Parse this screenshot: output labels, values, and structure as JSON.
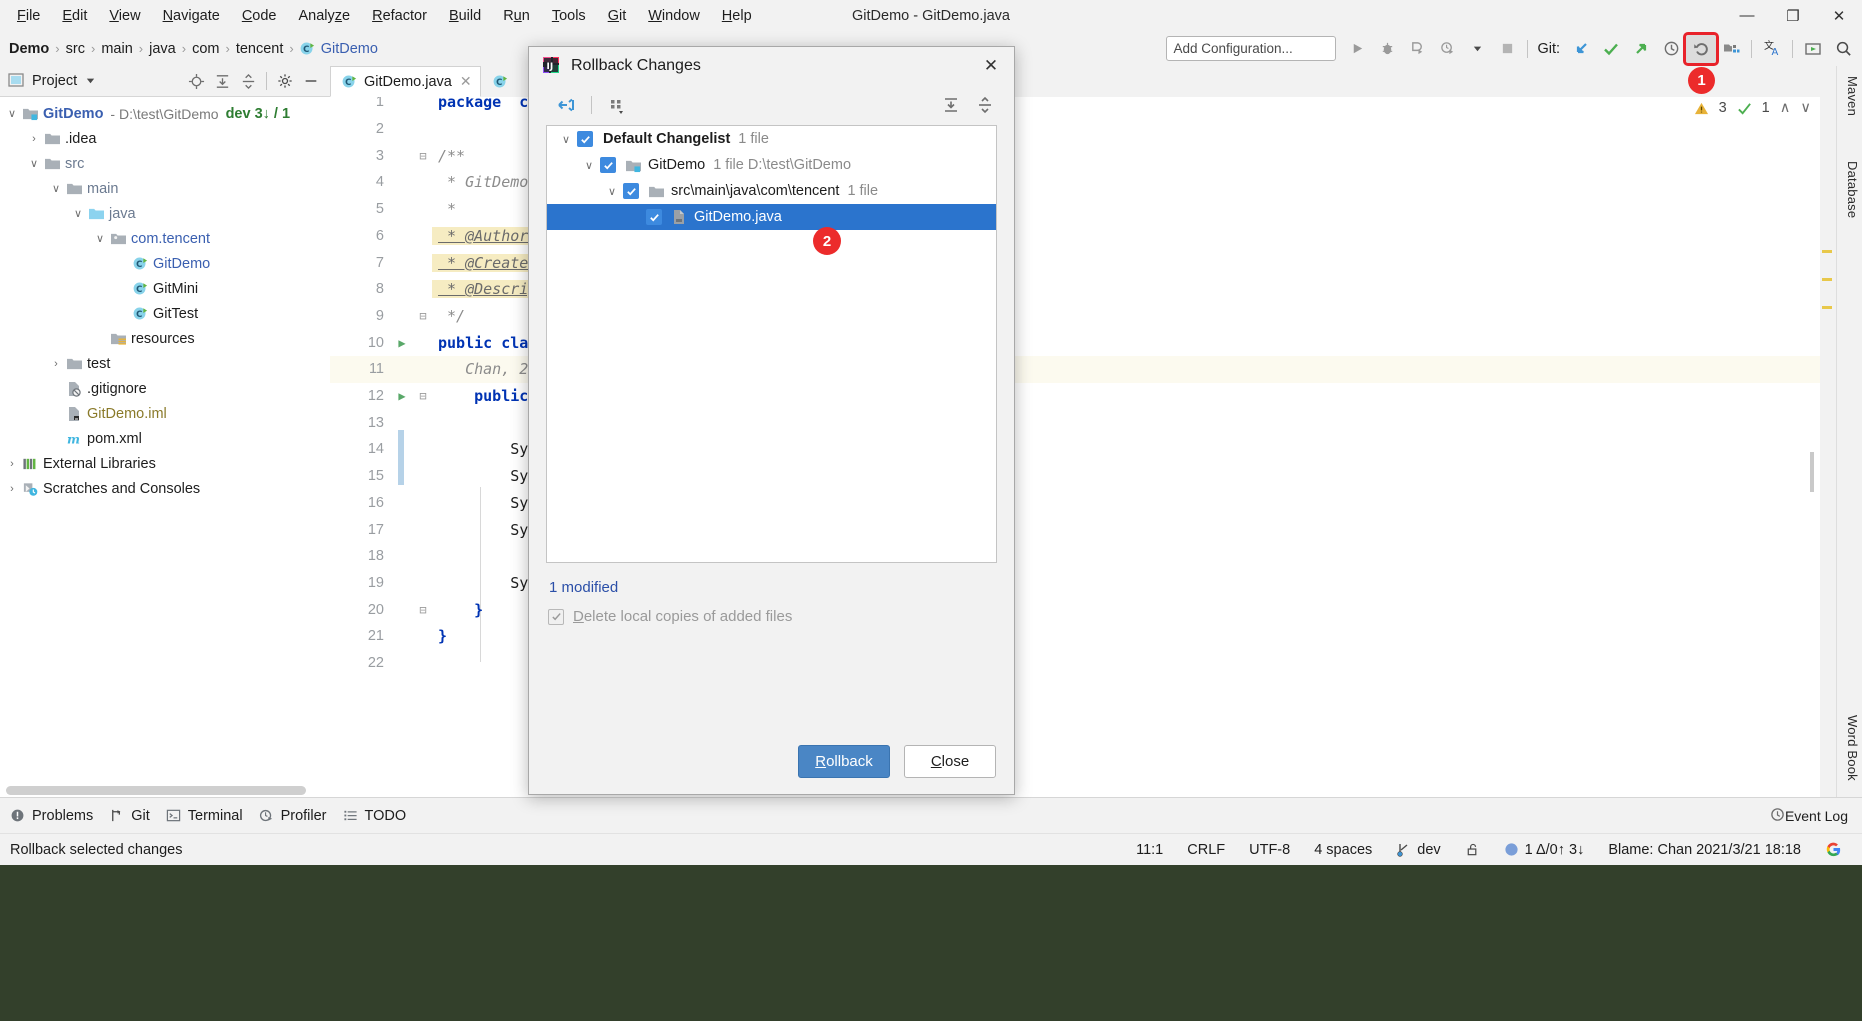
{
  "window": {
    "title": "GitDemo - GitDemo.java",
    "minimize": "—",
    "maximize": "❐",
    "close": "✕"
  },
  "menubar": [
    {
      "label": "File",
      "mn": "F"
    },
    {
      "label": "Edit",
      "mn": "E"
    },
    {
      "label": "View",
      "mn": "V"
    },
    {
      "label": "Navigate",
      "mn": "N"
    },
    {
      "label": "Code",
      "mn": "C"
    },
    {
      "label": "Analyze",
      "mn": "z"
    },
    {
      "label": "Refactor",
      "mn": "R"
    },
    {
      "label": "Build",
      "mn": "B"
    },
    {
      "label": "Run",
      "mn": "u"
    },
    {
      "label": "Tools",
      "mn": "T"
    },
    {
      "label": "Git",
      "mn": "G"
    },
    {
      "label": "Window",
      "mn": "W"
    },
    {
      "label": "Help",
      "mn": "H"
    }
  ],
  "breadcrumb": {
    "items": [
      "Demo",
      "src",
      "main",
      "java",
      "com",
      "tencent",
      "GitDemo"
    ],
    "separator": "›"
  },
  "toolbar": {
    "run_config_placeholder": "Add Configuration...",
    "git_label": "Git:",
    "badge_1": "1",
    "icons": [
      "run-icon",
      "debug-icon",
      "run-coverage-icon",
      "profile-icon",
      "dropdown-icon",
      "stop-icon",
      "git-update-icon",
      "git-commit-icon",
      "git-push-icon",
      "git-history-icon",
      "git-rollback-icon",
      "project-structure-icon",
      "translate-icon",
      "presentation-icon",
      "search-icon"
    ]
  },
  "project_panel": {
    "title": "Project",
    "tools": [
      "locate-icon",
      "expand-all-icon",
      "collapse-all-icon",
      "settings-icon",
      "hide-icon"
    ],
    "tree": [
      {
        "label": "GitDemo",
        "meta": "- D:\\test\\GitDemo",
        "branch": "dev 3↓ / 1",
        "indent": 0,
        "chev": "∨",
        "icon": "module-folder-icon",
        "style": "bold blue"
      },
      {
        "label": ".idea",
        "indent": 1,
        "chev": "›",
        "icon": "folder-icon",
        "style": ""
      },
      {
        "label": "src",
        "indent": 1,
        "chev": "∨",
        "icon": "folder-icon",
        "style": "grayblue"
      },
      {
        "label": "main",
        "indent": 2,
        "chev": "∨",
        "icon": "folder-icon",
        "style": "grayblue"
      },
      {
        "label": "java",
        "indent": 3,
        "chev": "∨",
        "icon": "source-folder-icon",
        "style": "grayblue"
      },
      {
        "label": "com.tencent",
        "indent": 4,
        "chev": "∨",
        "icon": "package-icon",
        "style": "blue"
      },
      {
        "label": "GitDemo",
        "indent": 5,
        "chev": "",
        "icon": "java-class-icon",
        "style": "blue"
      },
      {
        "label": "GitMini",
        "indent": 5,
        "chev": "",
        "icon": "java-class-icon",
        "style": ""
      },
      {
        "label": "GitTest",
        "indent": 5,
        "chev": "",
        "icon": "java-class-icon",
        "style": ""
      },
      {
        "label": "resources",
        "indent": 4,
        "chev": "",
        "icon": "resources-folder-icon",
        "style": ""
      },
      {
        "label": "test",
        "indent": 2,
        "chev": "›",
        "icon": "folder-icon",
        "style": ""
      },
      {
        "label": ".gitignore",
        "indent": 2,
        "chev": "",
        "icon": "gitignore-file-icon",
        "style": ""
      },
      {
        "label": "GitDemo.iml",
        "indent": 2,
        "chev": "",
        "icon": "iml-file-icon",
        "style": "olive"
      },
      {
        "label": "pom.xml",
        "indent": 2,
        "chev": "",
        "icon": "maven-icon",
        "style": ""
      },
      {
        "label": "External Libraries",
        "indent": 0,
        "chev": "›",
        "icon": "libraries-icon",
        "style": ""
      },
      {
        "label": "Scratches and Consoles",
        "indent": 0,
        "chev": "›",
        "icon": "scratches-icon",
        "style": ""
      }
    ]
  },
  "editor": {
    "tabs": [
      {
        "label": "GitDemo.java",
        "icon": "java-class-icon",
        "active": true,
        "close": "✕"
      },
      {
        "label": "",
        "icon": "java-class-icon",
        "active": false,
        "close": ""
      }
    ],
    "inspection": {
      "warnings": "3",
      "checks": "1",
      "warn_icon": "warning-triangle-icon",
      "check_icon": "check-icon",
      "up": "∧",
      "down": "∨"
    },
    "lines": [
      {
        "n": "1",
        "text": "package  com.",
        "cls": "k"
      },
      {
        "n": "2",
        "text": "",
        "cls": ""
      },
      {
        "n": "3",
        "text": "/**",
        "cls": "cm",
        "fold": "⊟"
      },
      {
        "n": "4",
        "text": " * GitDemo.j",
        "cls": "cm"
      },
      {
        "n": "5",
        "text": " *",
        "cls": "cm"
      },
      {
        "n": "6",
        "text": " * @Author:",
        "cls": "cmhl"
      },
      {
        "n": "7",
        "text": " * @CreateTi",
        "cls": "cmhl"
      },
      {
        "n": "8",
        "text": " * @Descript",
        "cls": "cmhl"
      },
      {
        "n": "9",
        "text": " */",
        "cls": "cm",
        "fold": "⊟"
      },
      {
        "n": "10",
        "text": "public class",
        "cls": "k",
        "mark": "▶"
      },
      {
        "n": "11",
        "text": "   Chan, 202",
        "cls": "cm",
        "hl": true
      },
      {
        "n": "12",
        "text": "    public s",
        "cls": "k",
        "mark": "▶",
        "fold": "⊟"
      },
      {
        "n": "13",
        "text": "",
        "cls": ""
      },
      {
        "n": "14",
        "text": "        Syst",
        "cls": ""
      },
      {
        "n": "15",
        "text": "        Syst",
        "cls": ""
      },
      {
        "n": "16",
        "text": "        Syst",
        "cls": ""
      },
      {
        "n": "17",
        "text": "        Syst",
        "cls": ""
      },
      {
        "n": "18",
        "text": "",
        "cls": ""
      },
      {
        "n": "19",
        "text": "        Syst",
        "cls": ""
      },
      {
        "n": "20",
        "text": "    }",
        "cls": "k",
        "fold": "⊟"
      },
      {
        "n": "21",
        "text": "}",
        "cls": "k"
      },
      {
        "n": "22",
        "text": "",
        "cls": ""
      }
    ]
  },
  "right_strip": {
    "labels": [
      "Maven",
      "Database",
      "Word Book"
    ]
  },
  "dialog": {
    "title": "Rollback Changes",
    "icon": "intellij-idea-icon",
    "close": "✕",
    "toolbar_icons": [
      "collapse-all-icon",
      "group-by-icon"
    ],
    "toolbar_right_icons": [
      "expand-all-icon",
      "collapse-all-icon"
    ],
    "tree": [
      {
        "label": "Default Changelist",
        "meta": "1 file",
        "indent": 0,
        "chev": "∨",
        "icon": "",
        "bold": true,
        "selected": false
      },
      {
        "label": "GitDemo",
        "meta": "1 file  D:\\test\\GitDemo",
        "indent": 1,
        "chev": "∨",
        "icon": "module-folder-icon",
        "bold": false,
        "selected": false
      },
      {
        "label": "src\\main\\java\\com\\tencent",
        "meta": "1 file",
        "indent": 2,
        "chev": "∨",
        "icon": "folder-icon",
        "bold": false,
        "selected": false
      },
      {
        "label": "GitDemo.java",
        "meta": "",
        "indent": 3,
        "chev": "",
        "icon": "java-file-icon",
        "bold": false,
        "selected": true
      }
    ],
    "badge_2": "2",
    "modified_text": "1 modified",
    "delete_checkbox_label": "Delete local copies of added files",
    "delete_checkbox_mnemonic": "D",
    "buttons": {
      "rollback": "Rollback",
      "rollback_mnemonic": "R",
      "close": "Close",
      "close_mnemonic": "C"
    }
  },
  "toolwindows": [
    {
      "label": "Problems",
      "icon": "problems-icon"
    },
    {
      "label": "Git",
      "icon": "git-branch-icon"
    },
    {
      "label": "Terminal",
      "icon": "terminal-icon"
    },
    {
      "label": "Profiler",
      "icon": "profiler-icon"
    },
    {
      "label": "TODO",
      "icon": "todo-icon"
    }
  ],
  "event_log": {
    "label": "Event Log",
    "icon": "event-log-icon"
  },
  "statusbar": {
    "message": "Rollback selected changes",
    "caret": "11:1",
    "line_separator": "CRLF",
    "encoding": "UTF-8",
    "indent": "4 spaces",
    "branch": "dev",
    "branch_icon": "git-branch-icon",
    "lock_icon": "lock-open-icon",
    "changes_icon": "circle-icon",
    "changes": "1 Δ/0↑ 3↓",
    "blame": "Blame: Chan 2021/3/21 18:18",
    "extra_icon": "google-icon"
  },
  "colors": {
    "accent_blue": "#2b74cd",
    "primary_button": "#4a86c5",
    "badge_red": "#ec2b2b",
    "highlight_red": "#e8222a",
    "link_blue": "#3a5fb0",
    "keyword_blue": "#0033b3",
    "comment_gray": "#8c8c8c",
    "comment_highlight": "#f6ecc2",
    "checkbox_blue": "#3d8adf",
    "desktop_green": "#33402b",
    "branch_green": "#2e7d32"
  }
}
